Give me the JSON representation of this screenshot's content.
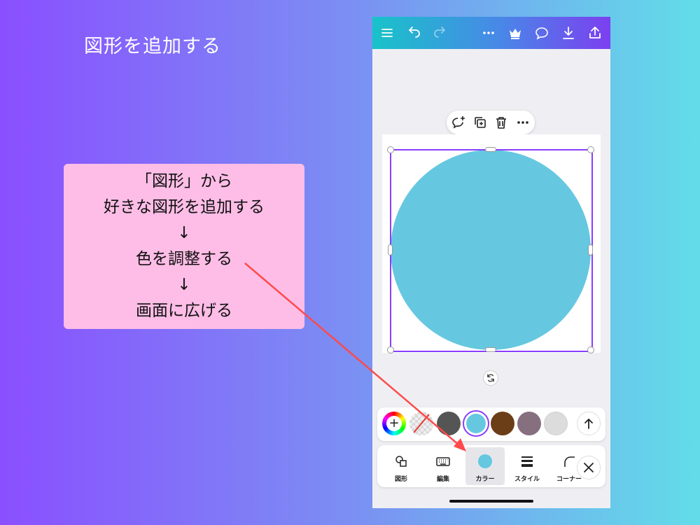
{
  "slide": {
    "title": "図形を追加する",
    "note_lines": [
      "「図形」から",
      "好きな図形を追加する",
      "↓",
      "色を調整する",
      "↓",
      "画面に広げる"
    ]
  },
  "app": {
    "topbar_icons": [
      "menu-icon",
      "undo-icon",
      "redo-icon",
      "more-icon",
      "crown-icon",
      "comment-icon",
      "download-icon",
      "share-icon"
    ],
    "float_actions": [
      "comment-add-icon",
      "duplicate-icon",
      "trash-icon",
      "more-icon"
    ],
    "shape": {
      "type": "circle",
      "color": "#65c8e0"
    },
    "palette": {
      "colors": [
        "#555555",
        "#65c8e0",
        "#6b3e17",
        "#86707f",
        "#dcdcdc"
      ],
      "selected": "#65c8e0"
    },
    "toolbar": {
      "shapes": "図形",
      "edit": "編集",
      "color": "カラー",
      "style": "スタイル",
      "corner": "コーナー"
    }
  },
  "colors": {
    "accent": "#8b3dff",
    "note_bg": "#fdbde6",
    "arrow": "#ff4a4a"
  }
}
